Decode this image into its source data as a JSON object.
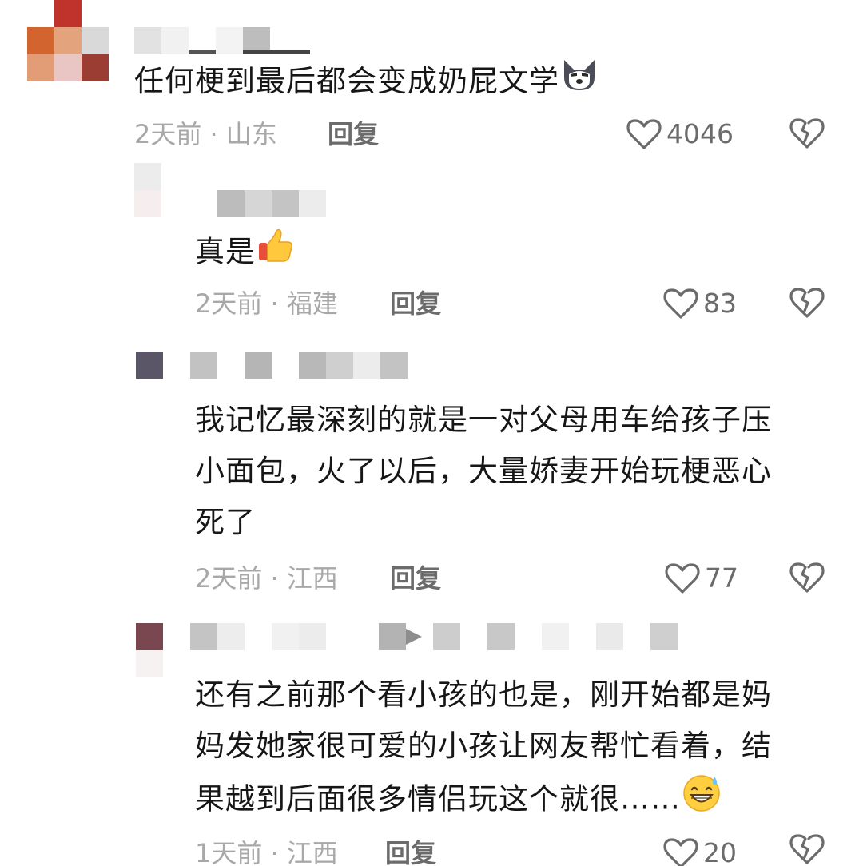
{
  "comments": [
    {
      "text": "任何梗到最后都会变成奶屁文学",
      "time": "2天前",
      "sep": "·",
      "location": "山东",
      "reply_label": "回复",
      "likes": "4046",
      "emoji": "husky-emoji"
    },
    {
      "text": "真是",
      "time": "2天前",
      "sep": "·",
      "location": "福建",
      "reply_label": "回复",
      "likes": "83",
      "emoji": "thumbs-up-emoji"
    },
    {
      "lines": [
        "我记忆最深刻的就是一对父母用车给孩子压",
        "小面包，火了以后，大量娇妻开始玩梗恶心",
        "死了"
      ],
      "time": "2天前",
      "sep": "·",
      "location": "江西",
      "reply_label": "回复",
      "likes": "77"
    },
    {
      "lines": [
        "还有之前那个看小孩的也是，刚开始都是妈",
        "妈发她家很可爱的小孩让网友帮忙看着，结",
        "果越到后面很多情侣玩这个就很……"
      ],
      "time": "1天前",
      "sep": "·",
      "location": "江西",
      "reply_label": "回复",
      "likes": "20",
      "emoji": "grinning-sweat-emoji"
    }
  ],
  "colors": {
    "text": "#161616",
    "meta": "#a8a8a8",
    "action": "#6b6b6b"
  },
  "icons": [
    "heart-outline-icon",
    "broken-heart-icon"
  ]
}
